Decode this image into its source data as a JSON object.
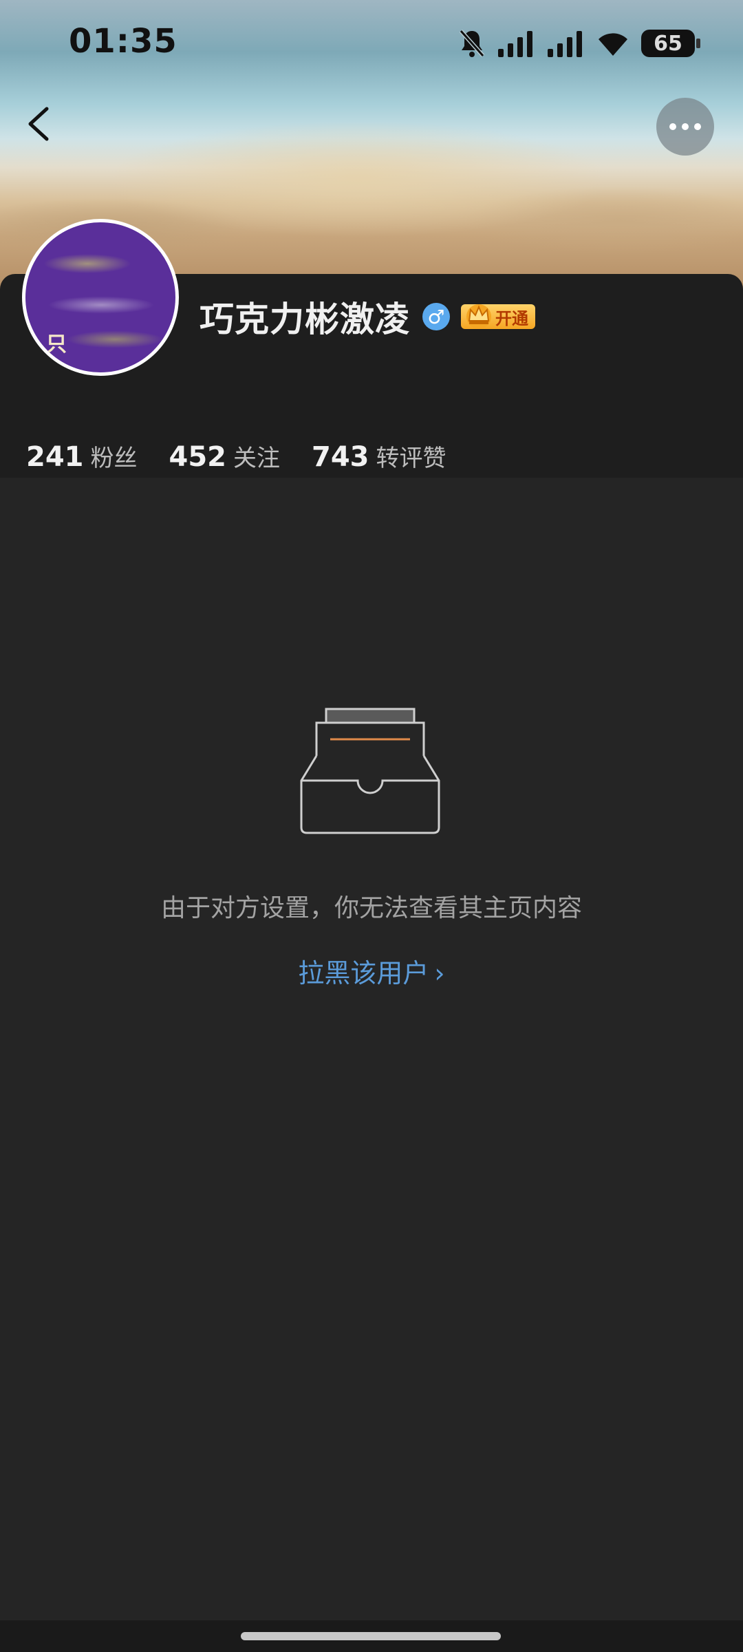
{
  "status_bar": {
    "time": "01:35",
    "battery": "65"
  },
  "profile": {
    "avatar_char": "只",
    "username": "巧克力彬激凌",
    "gender_symbol": "♂",
    "vip_label": "开通",
    "stats": [
      {
        "value": "241",
        "label": "粉丝"
      },
      {
        "value": "452",
        "label": "关注"
      },
      {
        "value": "743",
        "label": "转评赞"
      }
    ]
  },
  "empty_state": {
    "message": "由于对方设置，你无法查看其主页内容",
    "action_label": "拉黑该用户",
    "action_chevron": "›"
  },
  "icons": {
    "back": "chevron-left-icon",
    "more": "more-horizontal-icon",
    "mute": "bell-off-icon",
    "signal": "signal-icon",
    "wifi": "wifi-icon",
    "battery": "battery-icon",
    "gender": "male-icon",
    "vip": "crown-icon"
  },
  "colors": {
    "link": "#5b9bd9",
    "accent_vip": "#f5a623",
    "background": "#252525"
  }
}
